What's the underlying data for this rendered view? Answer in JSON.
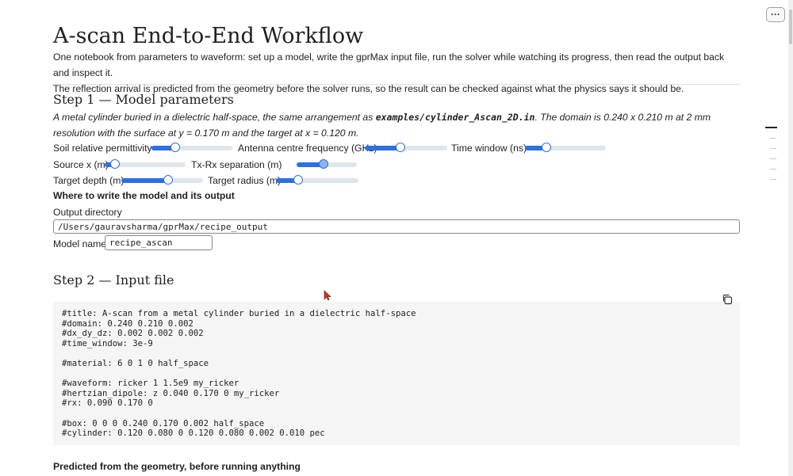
{
  "page": {
    "title": "A-scan End-to-End Workflow",
    "intro_line1": "One notebook from parameters to waveform: set up a model, write the gprMax input file, run the solver while watching its progress, then read the output back and inspect it.",
    "intro_line2": "The reflection arrival is predicted from the geometry before the solver runs, so the result can be checked against what the physics says it should be.",
    "menu_label": "···"
  },
  "step1": {
    "heading": "Step 1 — Model parameters",
    "desc_pre": "A metal cylinder buried in a dielectric half-space, the same arrangement as ",
    "desc_code": "examples/cylinder_Ascan_2D.in",
    "desc_post": ". The domain is 0.240 x 0.210 m at 2 mm resolution with the surface at y = 0.170 m and the target at x = 0.120 m.",
    "sliders": {
      "permittivity": {
        "label": "Soil relative permittivity",
        "fraction": 0.29
      },
      "frequency": {
        "label": "Antenna centre frequency (GHz)",
        "fraction": 0.43
      },
      "time_window": {
        "label": "Time window (ns)",
        "fraction": 0.26
      },
      "source_x": {
        "label": "Source x (m)",
        "fraction": 0.13
      },
      "separation": {
        "label": "Tx-Rx separation (m)",
        "fraction": 0.45
      },
      "target_depth": {
        "label": "Target depth (m)",
        "fraction": 0.57
      },
      "target_radius": {
        "label": "Target radius (m)",
        "fraction": 0.27
      }
    },
    "output_heading": "Where to write the model and its output",
    "output_dir_label": "Output directory",
    "output_dir_value": "/Users/gauravsharma/gprMax/recipe_output",
    "model_name_label": "Model name",
    "model_name_value": "recipe_ascan"
  },
  "step2": {
    "heading": "Step 2 — Input file",
    "code": "#title: A-scan from a metal cylinder buried in a dielectric half-space\n#domain: 0.240 0.210 0.002\n#dx_dy_dz: 0.002 0.002 0.002\n#time_window: 3e-9\n\n#material: 6 0 1 0 half_space\n\n#waveform: ricker 1 1.5e9 my_ricker\n#hertzian_dipole: z 0.040 0.170 0 my_ricker\n#rx: 0.090 0.170 0\n\n#box: 0 0 0 0.240 0.170 0.002 half_space\n#cylinder: 0.120 0.080 0 0.120 0.080 0.002 0.010 pec",
    "predicted_heading": "Predicted from the geometry, before running anything"
  },
  "icons": {
    "copy": "copy-icon",
    "menu": "ellipsis-icon",
    "cursor": "mouse-cursor-icon"
  },
  "colors": {
    "accent": "#2f6fdf",
    "track": "#dfe6ee",
    "code_bg": "#f5f5f5"
  }
}
